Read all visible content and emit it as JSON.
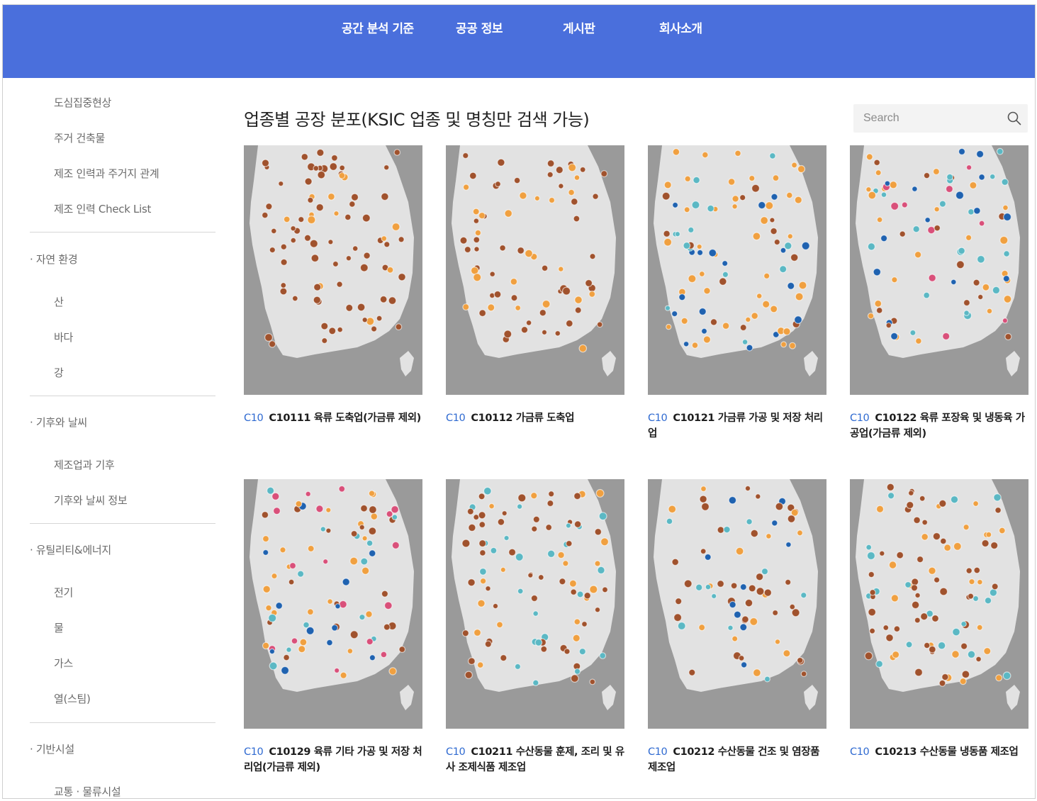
{
  "nav": {
    "items": [
      {
        "label": "공간 분석 기준"
      },
      {
        "label": "공공 정보"
      },
      {
        "label": "게시판"
      },
      {
        "label": "회사소개"
      }
    ]
  },
  "sidebar": {
    "top_items": [
      "도심집중현상",
      "주거 건축물",
      "제조 인력과 주거지 관계",
      "제조 인력 Check List"
    ],
    "nature": {
      "title": "· 자연 환경",
      "items": [
        "산",
        "바다",
        "강"
      ]
    },
    "climate": {
      "title": "· 기후와 날씨",
      "items": [
        "제조업과 기후",
        "기후와 날씨 정보"
      ]
    },
    "utility": {
      "title": "· 유틸리티&에너지",
      "items": [
        "전기",
        "물",
        "가스",
        "열(스팀)"
      ]
    },
    "infra": {
      "title": "· 기반시설",
      "items": [
        "교통 · 물류시설"
      ]
    }
  },
  "main": {
    "title": "업종별 공장 분포(KSIC 업종 및 명칭만 검색 가능)",
    "search": {
      "placeholder": "Search"
    },
    "cards": [
      {
        "tag": "C10",
        "title": "C10111 육류 도축업(가금류 제외)"
      },
      {
        "tag": "C10",
        "title": "C10112 가금류 도축업"
      },
      {
        "tag": "C10",
        "title": "C10121 가금류 가공 및 저장 처리업"
      },
      {
        "tag": "C10",
        "title": "C10122 육류 포장육 및 냉동육 가공업(가금류 제외)"
      },
      {
        "tag": "C10",
        "title": "C10129 육류 기타 가공 및 저장 처리업(가금류 제외)"
      },
      {
        "tag": "C10",
        "title": "C10211 수산동물 훈제, 조리 및 유사 조제식품 제조업"
      },
      {
        "tag": "C10",
        "title": "C10212 수산동물 건조 및 염장품 제조업"
      },
      {
        "tag": "C10",
        "title": "C10213 수산동물 냉동품 제조업"
      }
    ]
  },
  "colors": {
    "header": "#4a6fdc",
    "code": "#2f6ad1",
    "marker_brown": "#a0522d",
    "marker_orange": "#f0a040",
    "marker_teal": "#5bb8c4",
    "marker_blue": "#1f62b0",
    "marker_pink": "#d9507a"
  }
}
